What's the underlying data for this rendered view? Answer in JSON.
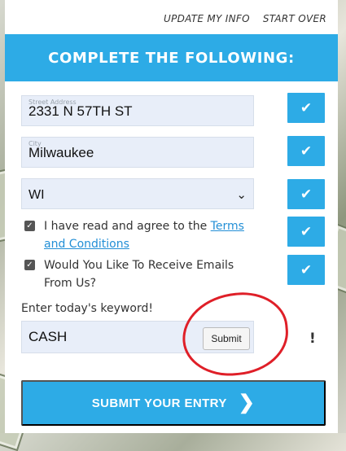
{
  "top_links": {
    "update": "UPDATE MY INFO",
    "start_over": "START OVER"
  },
  "banner": {
    "title": "COMPLETE THE FOLLOWING:"
  },
  "fields": {
    "street": {
      "label": "Street Address",
      "value": "2331 N 57TH ST"
    },
    "city": {
      "label": "City",
      "value": "Milwaukee"
    },
    "state": {
      "value": "WI"
    }
  },
  "agreements": {
    "terms_prefix": "I have read and agree to the ",
    "terms_link": "Terms and Conditions",
    "emails": "Would You Like To Receive Emails From Us?"
  },
  "keyword": {
    "label": "Enter today's keyword!",
    "value": "CASH",
    "submit_label": "Submit",
    "alert": "!"
  },
  "submit": {
    "label": "SUBMIT YOUR ENTRY",
    "arrow": "❯"
  },
  "icons": {
    "check": "check-icon",
    "chevron": "chevron-down-icon",
    "arrow": "chevron-right-icon"
  },
  "colors": {
    "accent": "#2dabe6",
    "field_bg": "#e8eef9",
    "annotation": "#df1f28"
  }
}
